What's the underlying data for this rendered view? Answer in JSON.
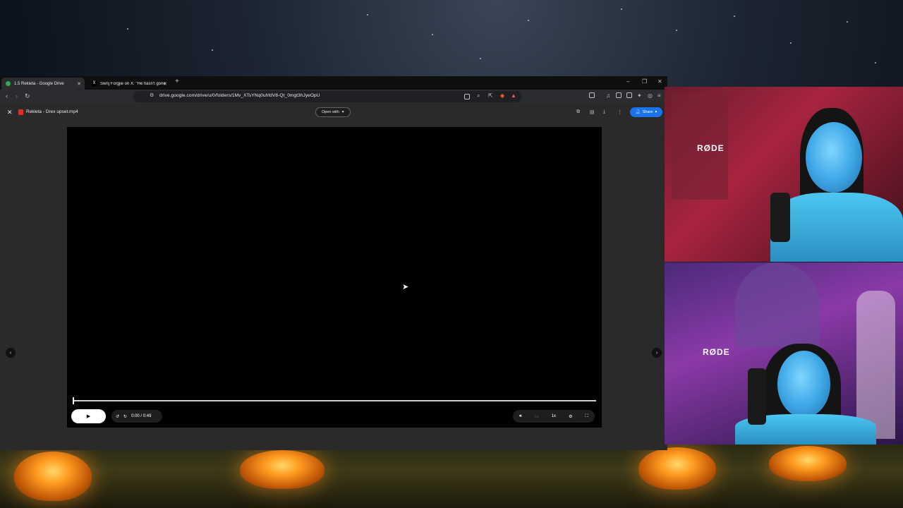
{
  "browser": {
    "tabs": [
      {
        "title": "1.5 Rekieta - Google Drive",
        "active": true
      },
      {
        "title": "Swnj Forgjie on X: \"He hasn't gone",
        "active": false
      }
    ],
    "url": "drive.google.com/drive/u/0/folders/1Mv_XTsYNq0uhfdV8-Qt_0mgt3hJyeOpU"
  },
  "viewer": {
    "file_name": "Rekieta - Drex upset.mp4",
    "open_with_label": "Open with",
    "share_label": "Share",
    "time": "0:00 / 0:49",
    "speed": "1x",
    "progress": 0.0
  },
  "webcams": {
    "mic_brand": "RØDE"
  },
  "colors": {
    "accent": "#1a73e8",
    "video_bg": "#000000",
    "viewer_bg": "#2a2a2a"
  }
}
